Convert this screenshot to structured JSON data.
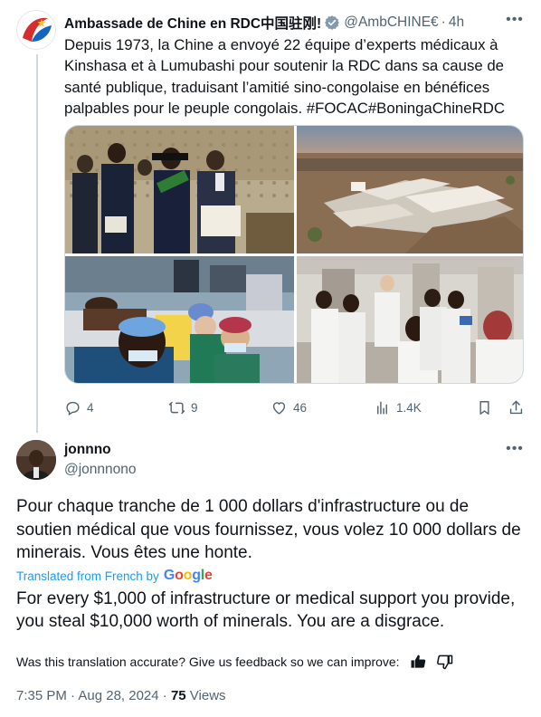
{
  "parent": {
    "name": "Ambassade de Chine en RDC中国驻刚!",
    "handle": "@AmbCHINE€",
    "dot": "·",
    "time": "4h",
    "text": "Depuis 1973, la Chine a envoyé 22 équipe d’experts médicaux à Kinshasa et à Lumubashi pour soutenir la RDC dans sa cause de santé publique, traduisant l’amitié sino-congolaise en bénéfices palpables pour le peuple congolais. #FOCAC#BoningaChineRDC",
    "actions": {
      "replies": "4",
      "reposts": "9",
      "likes": "46",
      "views": "1.4K"
    },
    "avatar_icon": "embassy-logo-icon"
  },
  "reply": {
    "name": "jonnno",
    "handle": "@jonnnono",
    "text": "Pour chaque tranche de 1 000 dollars d'infrastructure ou de soutien médical que vous fournissez, vous volez 10 000 dollars de minerais. Vous êtes une honte.",
    "translated_label": "Translated from French by",
    "google_letters": [
      "G",
      "o",
      "o",
      "g",
      "l",
      "e"
    ],
    "translation": "For every $1,000 of infrastructure or medical support you provide, you steal $10,000 worth of minerals. You are a disgrace.",
    "feedback_text": "Was this translation accurate? Give us feedback so we can improve:",
    "time": "7:35 PM · Aug 28, 2024 · ",
    "views_count": "75",
    "views_label": " Views"
  },
  "colors": {
    "accent": "#1d9bf0",
    "muted": "#536471",
    "text": "#0f1419",
    "border": "#cfd9de"
  }
}
